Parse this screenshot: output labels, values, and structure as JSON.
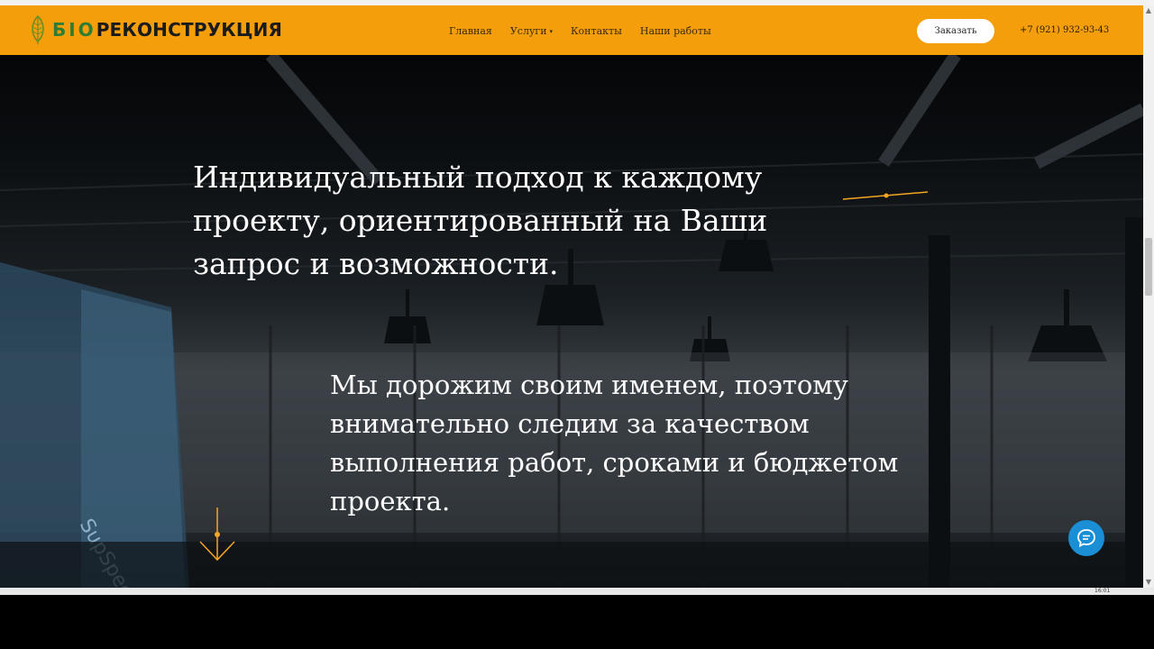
{
  "logo": {
    "prefix": "БIO",
    "name": "РЕКОНСТРУКЦИЯ"
  },
  "nav": {
    "items": [
      {
        "label": "Главная"
      },
      {
        "label": "Услуги",
        "has_dropdown": true
      },
      {
        "label": "Контакты"
      },
      {
        "label": "Наши работы"
      }
    ]
  },
  "header": {
    "order_button": "Заказать",
    "phone": "+7 (921) 932-93-43"
  },
  "hero": {
    "headline": "Индивидуальный подход к каждому проекту, ориентированный на Ваши запрос и возможности.",
    "subtext": "Мы дорожим своим именем, поэтому внимательно следим за качеством выполнения работ, сроками и бюджетом проекта.",
    "wall_sign": "SupSpeed"
  },
  "taskbar": {
    "clock": "16:01"
  },
  "colors": {
    "header_bg": "#f59e0c",
    "accent": "#f5a623",
    "chat_button": "#1a8fd6",
    "logo_green": "#2e7d32"
  },
  "icons": {
    "logo": "leaf-icon",
    "dropdown": "chevron-down-icon",
    "scroll_down": "arrow-down-icon",
    "chat": "chat-bubble-icon"
  }
}
